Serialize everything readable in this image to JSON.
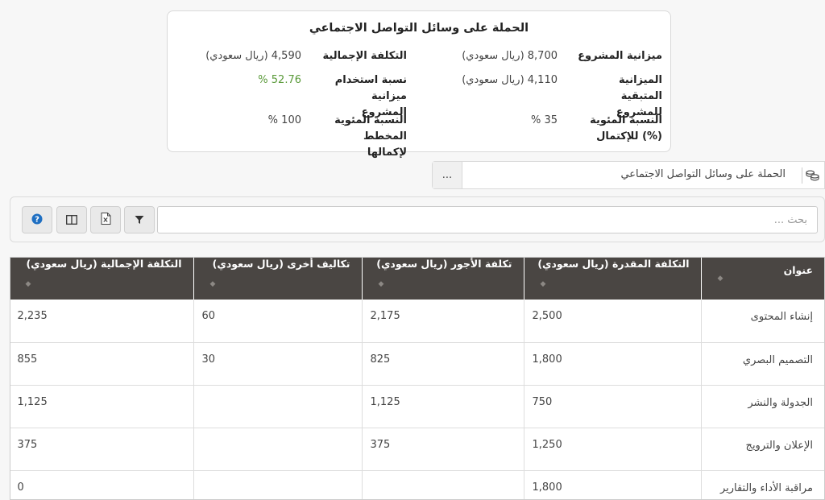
{
  "summary": {
    "title": "الحملة على وسائل التواصل الاجتماعي",
    "project_budget_label": "ميزانية المشروع",
    "project_budget_value": "8,700 (ريال سعودي)",
    "total_cost_label": "التكلفة الإجمالية",
    "total_cost_value": "4,590 (ريال سعودي)",
    "remaining_budget_label": "الميزانية المتبقية للمشروع",
    "remaining_budget_value": "4,110 (ريال سعودي)",
    "budget_usage_label": "نسبة استخدام ميزانية المشروع",
    "budget_usage_value": "52.76 %",
    "completion_label": "النسبة المئوية (%) للإكتمال",
    "completion_value": "35 %",
    "planned_completion_label": "النسبة المئوية المخطط لإكمالها",
    "planned_completion_value": "100 %"
  },
  "project_selector": {
    "name": "الحملة على وسائل التواصل الاجتماعي",
    "more_label": "...",
    "icon": "coins-icon"
  },
  "toolbar": {
    "search_placeholder": "بحث ...",
    "icons": [
      "filter-icon",
      "excel-export-icon",
      "columns-icon",
      "help-icon"
    ]
  },
  "table": {
    "headers": [
      "عنوان",
      "التكلفة المقدرة (ريال سعودي)",
      "تكلفة الأجور (ريال سعودي)",
      "تكاليف أخرى (ريال سعودي)",
      "التكلفة الإجمالية (ريال سعودي)"
    ],
    "rows": [
      [
        "إنشاء المحتوى",
        "2,500",
        "2,175",
        "60",
        "2,235"
      ],
      [
        "التصميم البصري",
        "1,800",
        "825",
        "30",
        "855"
      ],
      [
        "الجدولة والنشر",
        "750",
        "1,125",
        "",
        "1,125"
      ],
      [
        "الإعلان والترويج",
        "1,250",
        "375",
        "",
        "375"
      ],
      [
        "مراقبة الأداء والتقارير",
        "1,800",
        "",
        "",
        "0"
      ]
    ]
  },
  "colors": {
    "header_bg": "#4a4643",
    "accent_green": "#5a9a3a",
    "help_blue": "#1f6fc2"
  }
}
